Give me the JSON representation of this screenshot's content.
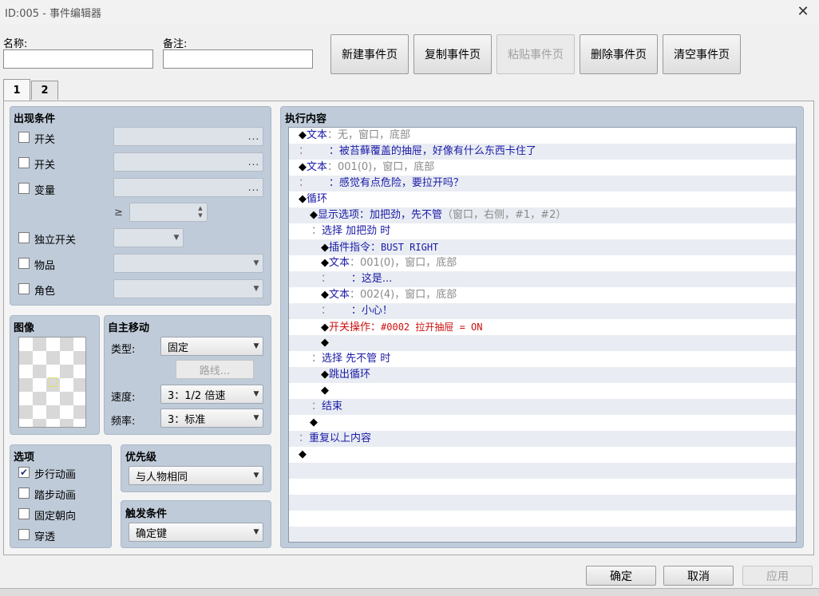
{
  "window": {
    "title": "ID:005 - 事件编辑器"
  },
  "form": {
    "name_label": "名称:",
    "name_value": "",
    "note_label": "备注:",
    "note_value": ""
  },
  "page_buttons": {
    "new": "新建事件页",
    "copy": "复制事件页",
    "paste": "粘贴事件页",
    "delete": "删除事件页",
    "clear": "清空事件页"
  },
  "tabs": [
    "1",
    "2"
  ],
  "conditions": {
    "title": "出现条件",
    "switch1_label": "开关",
    "switch2_label": "开关",
    "variable_label": "变量",
    "gte_symbol": "≥",
    "self_switch_label": "独立开关",
    "item_label": "物品",
    "actor_label": "角色",
    "dots": "..."
  },
  "image": {
    "title": "图像"
  },
  "autonomous": {
    "title": "自主移动",
    "type_label": "类型:",
    "type_value": "固定",
    "route_button": "路线...",
    "speed_label": "速度:",
    "speed_value": "3：1/2 倍速",
    "freq_label": "频率:",
    "freq_value": "3：标准"
  },
  "options": {
    "title": "选项",
    "walking_anim": "步行动画",
    "walking_checked": "✔",
    "stepping_anim": "踏步动画",
    "direction_fix": "固定朝向",
    "through": "穿透"
  },
  "priority": {
    "title": "优先级",
    "value": "与人物相同"
  },
  "trigger": {
    "title": "触发条件",
    "value": "确定键"
  },
  "contents": {
    "title": "执行内容",
    "rows": [
      {
        "indent": 12,
        "parts": [
          [
            "c-black",
            "◆"
          ],
          [
            "c-blue",
            "文本"
          ],
          [
            "c-gray",
            "：无，窗口，底部"
          ]
        ]
      },
      {
        "indent": 12,
        "parts": [
          [
            "c-gray",
            "："
          ],
          [
            "c-gray",
            "      "
          ],
          [
            "c-blue",
            "：被苔藓覆盖的抽屉，好像有什么东西卡住了"
          ]
        ]
      },
      {
        "indent": 12,
        "parts": [
          [
            "c-black",
            "◆"
          ],
          [
            "c-blue",
            "文本"
          ],
          [
            "c-gray",
            "：001(0)，窗口，底部"
          ]
        ]
      },
      {
        "indent": 12,
        "parts": [
          [
            "c-gray",
            "："
          ],
          [
            "c-gray",
            "      "
          ],
          [
            "c-blue",
            "：感觉有点危险，要拉开吗？"
          ]
        ]
      },
      {
        "indent": 12,
        "parts": [
          [
            "c-black",
            "◆"
          ],
          [
            "c-blue",
            "循环"
          ]
        ]
      },
      {
        "indent": 26,
        "parts": [
          [
            "c-black",
            "◆"
          ],
          [
            "c-blue",
            "显示选项：加把劲，先不管"
          ],
          [
            "c-gray",
            "（窗口，右侧，#1，#2）"
          ]
        ]
      },
      {
        "indent": 28,
        "parts": [
          [
            "c-gray",
            "："
          ],
          [
            "c-blue",
            "选择 加把劲 时"
          ]
        ]
      },
      {
        "indent": 40,
        "parts": [
          [
            "c-black",
            "◆"
          ],
          [
            "c-blue",
            "插件指令："
          ],
          [
            "c-blue mono",
            "BUST RIGHT"
          ]
        ]
      },
      {
        "indent": 40,
        "parts": [
          [
            "c-black",
            "◆"
          ],
          [
            "c-blue",
            "文本"
          ],
          [
            "c-gray",
            "：001(0)，窗口，底部"
          ]
        ]
      },
      {
        "indent": 40,
        "parts": [
          [
            "c-gray",
            "："
          ],
          [
            "c-gray",
            "      "
          ],
          [
            "c-blue",
            "：这是..."
          ]
        ]
      },
      {
        "indent": 40,
        "parts": [
          [
            "c-black",
            "◆"
          ],
          [
            "c-blue",
            "文本"
          ],
          [
            "c-gray",
            "：002(4)，窗口，底部"
          ]
        ]
      },
      {
        "indent": 40,
        "parts": [
          [
            "c-gray",
            "："
          ],
          [
            "c-gray",
            "      "
          ],
          [
            "c-blue",
            "：小心！"
          ]
        ]
      },
      {
        "indent": 40,
        "parts": [
          [
            "c-black",
            "◆"
          ],
          [
            "c-red",
            "开关操作："
          ],
          [
            "c-red mono",
            "#0002 拉开抽屉 = ON"
          ]
        ]
      },
      {
        "indent": 40,
        "parts": [
          [
            "c-black",
            "◆"
          ]
        ]
      },
      {
        "indent": 28,
        "parts": [
          [
            "c-gray",
            "："
          ],
          [
            "c-blue",
            "选择 先不管 时"
          ]
        ]
      },
      {
        "indent": 40,
        "parts": [
          [
            "c-black",
            "◆"
          ],
          [
            "c-blue",
            "跳出循环"
          ]
        ]
      },
      {
        "indent": 40,
        "parts": [
          [
            "c-black",
            "◆"
          ]
        ]
      },
      {
        "indent": 28,
        "parts": [
          [
            "c-gray",
            "："
          ],
          [
            "c-blue",
            "结束"
          ]
        ]
      },
      {
        "indent": 26,
        "parts": [
          [
            "c-black",
            "◆"
          ]
        ]
      },
      {
        "indent": 12,
        "parts": [
          [
            "c-gray",
            "："
          ],
          [
            "c-blue",
            "重复以上内容"
          ]
        ]
      },
      {
        "indent": 12,
        "parts": [
          [
            "c-black",
            "◆"
          ]
        ]
      },
      {
        "indent": 12,
        "parts": []
      },
      {
        "indent": 12,
        "parts": []
      },
      {
        "indent": 12,
        "parts": []
      },
      {
        "indent": 12,
        "parts": []
      },
      {
        "indent": 12,
        "parts": []
      }
    ]
  },
  "dialog_buttons": {
    "ok": "确定",
    "cancel": "取消",
    "apply": "应用"
  },
  "colors": {
    "pane": "#bfcbd9",
    "list_alt": "#e9edf3",
    "text_blue": "#1a1aa6",
    "text_red": "#cc1010"
  }
}
